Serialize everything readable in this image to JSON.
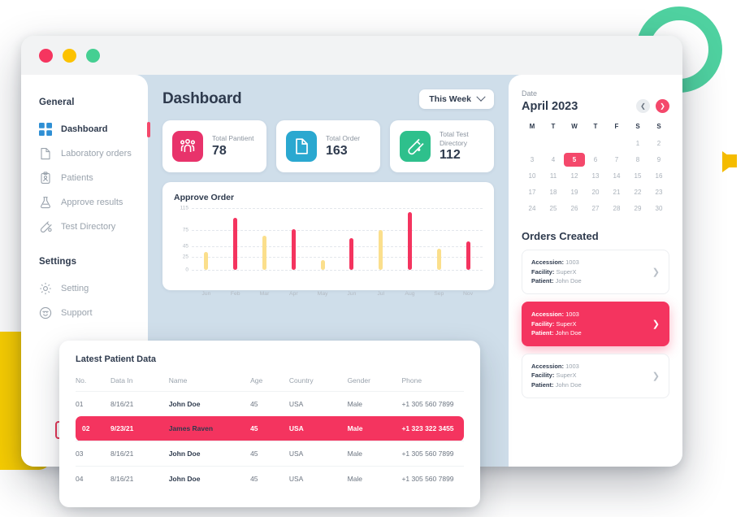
{
  "window": {
    "traffic_lights": [
      "close",
      "minimize",
      "maximize"
    ]
  },
  "sidebar": {
    "group_general": "General",
    "group_settings": "Settings",
    "items": [
      {
        "label": "Dashboard",
        "icon": "grid-icon",
        "active": true
      },
      {
        "label": "Laboratory orders",
        "icon": "document-icon",
        "active": false
      },
      {
        "label": "Patients",
        "icon": "clipboard-person-icon",
        "active": false
      },
      {
        "label": "Approve results",
        "icon": "flask-icon",
        "active": false
      },
      {
        "label": "Test Directory",
        "icon": "test-tube-icon",
        "active": false
      }
    ],
    "settings_items": [
      {
        "label": "Setting",
        "icon": "gear-icon"
      },
      {
        "label": "Support",
        "icon": "headset-icon"
      }
    ]
  },
  "header": {
    "title": "Dashboard",
    "period_selector": "This Week"
  },
  "stats": [
    {
      "label": "Total Pantient",
      "value": "78",
      "icon": "patients-icon",
      "color": "#e8336b"
    },
    {
      "label": "Total Order",
      "value": "163",
      "icon": "order-document-icon",
      "color": "#2aa8d0"
    },
    {
      "label": "Total Test\nDirectory",
      "label_line1": "Total Test",
      "label_line2": "Directory",
      "value": "112",
      "icon": "test-tube-icon",
      "color": "#2ec08c"
    }
  ],
  "chart_data": {
    "type": "bar",
    "title": "Approve Order",
    "categories": [
      "Jun",
      "Feb",
      "Mar",
      "Apr",
      "May",
      "Jun",
      "Jul",
      "Aug",
      "Sep",
      "Nov"
    ],
    "values": [
      34,
      97,
      64,
      76,
      19,
      59,
      74,
      108,
      39,
      53
    ],
    "colors": [
      "#fbdf8c",
      "#f4345f",
      "#fbdf8c",
      "#f4345f",
      "#fbdf8c",
      "#f4345f",
      "#fbdf8c",
      "#f4345f",
      "#fbdf8c",
      "#f4345f"
    ],
    "xlabel": "",
    "ylabel": "",
    "yticks": [
      0,
      25,
      45,
      75,
      115
    ],
    "ylim": [
      0,
      115
    ],
    "grid": true,
    "legend": "none"
  },
  "calendar": {
    "date_label": "Date",
    "month": "April 2023",
    "prev_icon": "chevron-left-icon",
    "next_icon": "chevron-right-icon",
    "dow": [
      "M",
      "T",
      "W",
      "T",
      "F",
      "S",
      "S"
    ],
    "weeks": [
      [
        "",
        "",
        "",
        "",
        "",
        "1",
        "2"
      ],
      [
        "3",
        "4",
        "5",
        "6",
        "7",
        "8",
        "9"
      ],
      [
        "10",
        "11",
        "12",
        "13",
        "14",
        "15",
        "16"
      ],
      [
        "17",
        "18",
        "19",
        "20",
        "21",
        "22",
        "23"
      ],
      [
        "24",
        "25",
        "26",
        "27",
        "28",
        "29",
        "30"
      ]
    ],
    "selected": "5"
  },
  "orders": {
    "title": "Orders Created",
    "keys": {
      "accession": "Accession:",
      "facility": "Facility:",
      "patient": "Patient:"
    },
    "arrow_icon": "chevron-right-icon",
    "items": [
      {
        "accession": "1003",
        "facility": "SuperX",
        "patient": "John Doe",
        "selected": false
      },
      {
        "accession": "1003",
        "facility": "SuperX",
        "patient": "John Doe",
        "selected": true
      },
      {
        "accession": "1003",
        "facility": "SuperX",
        "patient": "John Doe",
        "selected": false
      }
    ]
  },
  "patient_table": {
    "title": "Latest Patient Data",
    "columns": [
      "No.",
      "Data In",
      "Name",
      "Age",
      "Country",
      "Gender",
      "Phone"
    ],
    "rows": [
      {
        "no": "01",
        "data_in": "8/16/21",
        "name": "John Doe",
        "age": "45",
        "country": "USA",
        "gender": "Male",
        "phone": "+1 305 560 7899",
        "highlighted": false
      },
      {
        "no": "02",
        "data_in": "9/23/21",
        "name": "James Raven",
        "age": "45",
        "country": "USA",
        "gender": "Male",
        "phone": "+1 323 322 3455",
        "highlighted": true
      },
      {
        "no": "03",
        "data_in": "8/16/21",
        "name": "John Doe",
        "age": "45",
        "country": "USA",
        "gender": "Male",
        "phone": "+1 305 560 7899",
        "highlighted": false
      },
      {
        "no": "04",
        "data_in": "8/16/21",
        "name": "John Doe",
        "age": "45",
        "country": "USA",
        "gender": "Male",
        "phone": "+1 305 560 7899",
        "highlighted": false
      }
    ]
  },
  "theme": {
    "accent_pink": "#f4345f",
    "accent_yellow": "#fbdf8c",
    "accent_green": "#4fd1a0",
    "background": "#cfdeea",
    "text_dark": "#2e3a4d",
    "text_muted": "#9aa3ad"
  }
}
